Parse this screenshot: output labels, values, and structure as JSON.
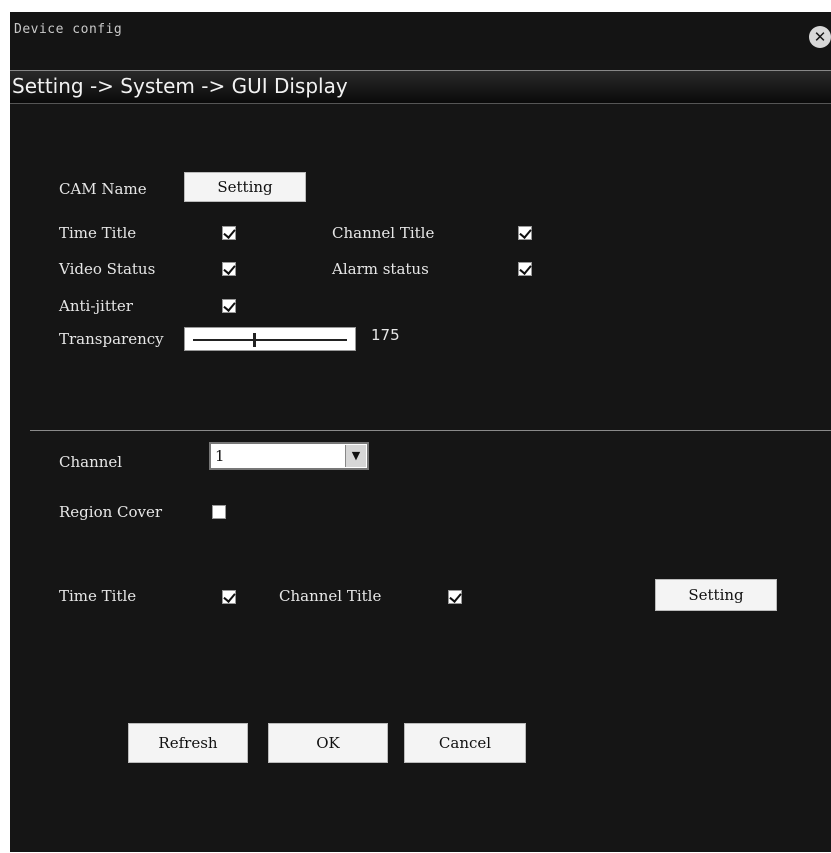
{
  "window": {
    "title": "Device config",
    "close_icon": "close-icon"
  },
  "breadcrumb": "Setting -> System -> GUI Display",
  "global": {
    "cam_name_label": "CAM Name",
    "cam_name_button": "Setting",
    "time_title_label": "Time Title",
    "time_title_checked": true,
    "channel_title_label": "Channel Title",
    "channel_title_checked": true,
    "video_status_label": "Video Status",
    "video_status_checked": true,
    "alarm_status_label": "Alarm status",
    "alarm_status_checked": true,
    "anti_jitter_label": "Anti-jitter",
    "anti_jitter_checked": true,
    "transparency_label": "Transparency",
    "transparency_value": "175"
  },
  "channel": {
    "channel_label": "Channel",
    "channel_value": "1",
    "region_cover_label": "Region Cover",
    "region_cover_checked": false,
    "time_title_label": "Time Title",
    "time_title_checked": true,
    "channel_title_label": "Channel Title",
    "channel_title_checked": true,
    "setting_button": "Setting"
  },
  "footer": {
    "refresh": "Refresh",
    "ok": "OK",
    "cancel": "Cancel"
  }
}
